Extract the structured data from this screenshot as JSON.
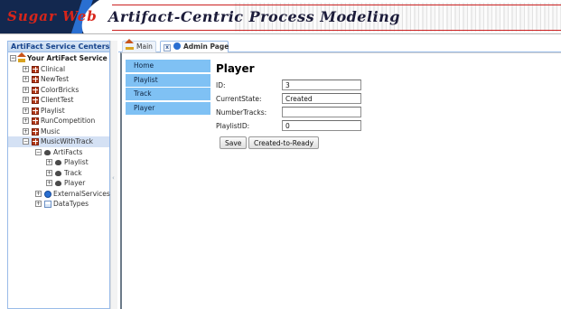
{
  "banner": {
    "logo_text": "Sugar Web",
    "title": "Artifact-Centric Process Modeling"
  },
  "sidebar": {
    "header": "ArtiFact Service Centers",
    "root": "Your ArtiFact Service",
    "items": [
      {
        "label": "Clinical",
        "icon": "grid-icon"
      },
      {
        "label": "NewTest",
        "icon": "grid-icon"
      },
      {
        "label": "ColorBricks",
        "icon": "grid-icon"
      },
      {
        "label": "ClientTest",
        "icon": "grid-icon"
      },
      {
        "label": "Playlist",
        "icon": "grid-icon"
      },
      {
        "label": "RunCompetition",
        "icon": "grid-icon"
      },
      {
        "label": "Music",
        "icon": "grid-icon"
      },
      {
        "label": "MusicWithTrack",
        "icon": "grid-icon",
        "selected": true
      }
    ],
    "children": {
      "artifacts": "ArtiFacts",
      "artifact_items": [
        "Playlist",
        "Track",
        "Player"
      ],
      "external": "ExternalServices",
      "datatypes": "DataTypes"
    }
  },
  "tabs": [
    {
      "label": "Main",
      "icon": "home-icon",
      "active": false
    },
    {
      "label": "Admin Page",
      "icon": "admin-icon",
      "active": true,
      "closable": true
    }
  ],
  "menu": {
    "items": [
      "Home",
      "Playlist",
      "Track",
      "Player"
    ]
  },
  "form": {
    "title": "Player",
    "fields": [
      {
        "label": "ID:",
        "value": "3"
      },
      {
        "label": "CurrentState:",
        "value": "Created"
      },
      {
        "label": "NumberTracks:",
        "value": ""
      },
      {
        "label": "PlaylistID:",
        "value": "0"
      }
    ],
    "save_label": "Save",
    "transition_label": "Created-to-Ready"
  },
  "colors": {
    "menu_bg": "#7fc1f4",
    "selected_row": "#d4e1f4",
    "panel_border": "#99bbe8"
  }
}
